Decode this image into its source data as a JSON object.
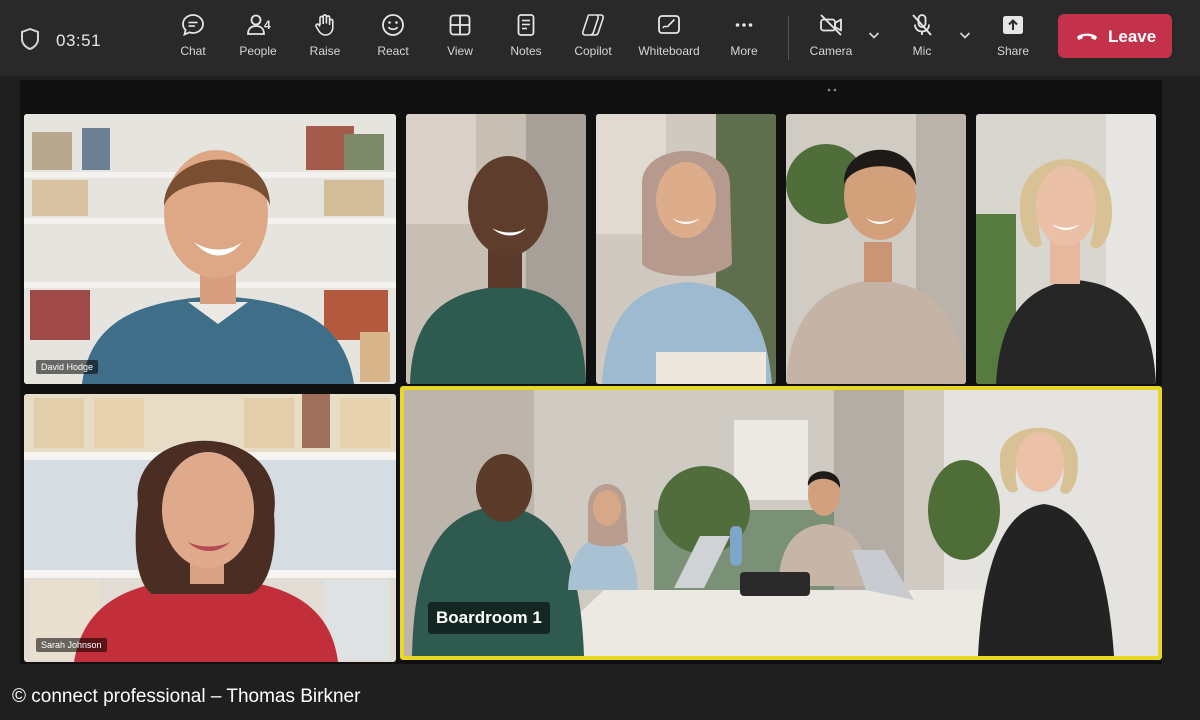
{
  "topbar": {
    "timer": "03:51",
    "controls": [
      {
        "id": "chat",
        "label": "Chat",
        "icon": "chat-icon"
      },
      {
        "id": "people",
        "label": "People",
        "icon": "people-icon",
        "count": "4"
      },
      {
        "id": "raise",
        "label": "Raise",
        "icon": "raise-hand-icon"
      },
      {
        "id": "react",
        "label": "React",
        "icon": "smiley-icon"
      },
      {
        "id": "view",
        "label": "View",
        "icon": "grid-view-icon"
      },
      {
        "id": "notes",
        "label": "Notes",
        "icon": "notes-icon"
      },
      {
        "id": "copilot",
        "label": "Copilot",
        "icon": "copilot-icon"
      },
      {
        "id": "whiteboard",
        "label": "Whiteboard",
        "icon": "whiteboard-icon"
      },
      {
        "id": "more",
        "label": "More",
        "icon": "more-dots-icon"
      },
      {
        "id": "camera",
        "label": "Camera",
        "icon": "camera-off-icon"
      },
      {
        "id": "mic",
        "label": "Mic",
        "icon": "mic-off-icon"
      },
      {
        "id": "share",
        "label": "Share",
        "icon": "share-icon"
      }
    ],
    "leave_label": "Leave"
  },
  "participants": [
    {
      "name": "David Hodge"
    },
    {
      "name": "Sarah Johnson"
    }
  ],
  "room": {
    "name": "Boardroom 1"
  },
  "colors": {
    "topbar": "#292929",
    "leave": "#c4314b",
    "active_speaker": "#e8d825",
    "stage": "#101010"
  },
  "credit": "© connect professional – Thomas Birkner"
}
